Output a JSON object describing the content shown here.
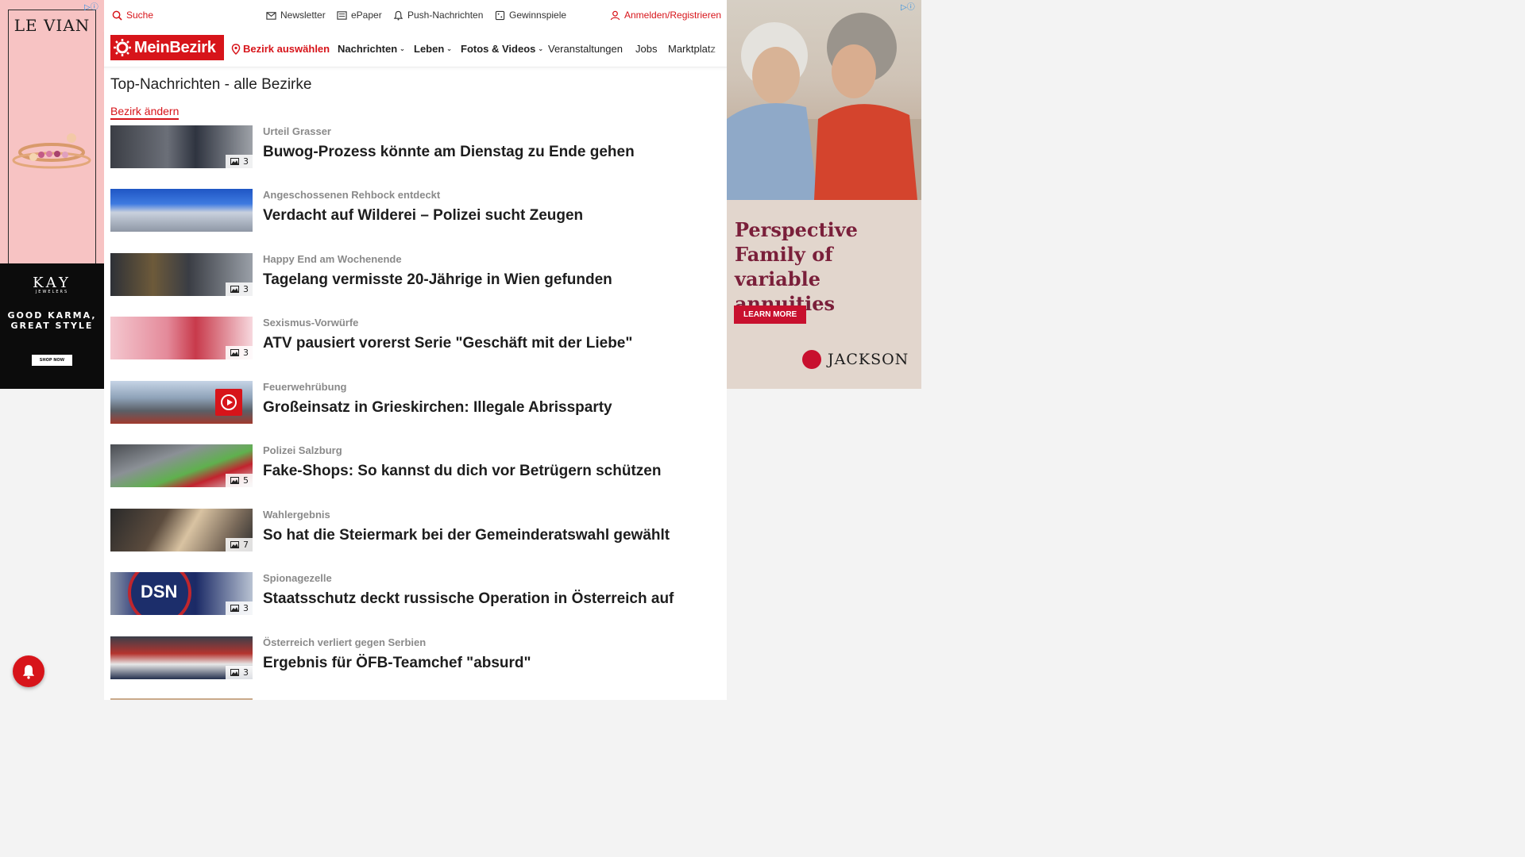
{
  "left_ad": {
    "brand": "LE VIAN",
    "kay_logo": "KAY",
    "kay_sub": "JEWELERS",
    "slogan_line1": "GOOD KARMA,",
    "slogan_line2": "GREAT STYLE",
    "cta": "SHOP NOW"
  },
  "utility_bar": {
    "search": "Suche",
    "newsletter": "Newsletter",
    "epaper": "ePaper",
    "push": "Push-Nachrichten",
    "contests": "Gewinnspiele",
    "login": "Anmelden/Registrieren"
  },
  "nav": {
    "logo": "MeinBezirk",
    "district": "Bezirk auswählen",
    "items": [
      {
        "label": "Nachrichten",
        "has_dropdown": true
      },
      {
        "label": "Leben",
        "has_dropdown": true
      },
      {
        "label": "Fotos & Videos",
        "has_dropdown": true
      },
      {
        "label": "Veranstaltungen",
        "has_dropdown": false
      },
      {
        "label": "Jobs",
        "has_dropdown": false
      },
      {
        "label": "Marktplatz",
        "has_dropdown": false
      }
    ]
  },
  "page": {
    "title": "Top-Nachrichten - alle Bezirke",
    "change_district": "Bezirk ändern"
  },
  "articles": [
    {
      "kicker": "Urteil Grasser",
      "headline": "Buwog-Prozess könnte am Dienstag zu Ende gehen",
      "photos": "3"
    },
    {
      "kicker": "Angeschossenen Rehbock entdeckt",
      "headline": "Verdacht auf Wilderei – Polizei sucht Zeugen",
      "photos": ""
    },
    {
      "kicker": "Happy End am Wochenende",
      "headline": "Tagelang vermisste 20-Jährige in Wien gefunden",
      "photos": "3"
    },
    {
      "kicker": "Sexismus-Vorwürfe",
      "headline": "ATV pausiert vorerst Serie \"Geschäft mit der Liebe\"",
      "photos": "3"
    },
    {
      "kicker": "Feuerwehrübung",
      "headline": "Großeinsatz in Grieskirchen: Illegale Abrissparty",
      "photos": "",
      "video": true
    },
    {
      "kicker": "Polizei Salzburg",
      "headline": "Fake-Shops: So kannst du dich vor Betrügern schützen",
      "photos": "5"
    },
    {
      "kicker": "Wahlergebnis",
      "headline": "So hat die Steiermark bei der Gemeinderatswahl gewählt",
      "photos": "7"
    },
    {
      "kicker": "Spionagezelle",
      "headline": "Staatsschutz deckt russische Operation in Österreich auf",
      "photos": "3",
      "thumb_text": "DSN"
    },
    {
      "kicker": "Österreich verliert gegen Serbien",
      "headline": "Ergebnis für ÖFB-Teamchef \"absurd\"",
      "photos": "3"
    }
  ],
  "right_ad": {
    "line1": "Perspective",
    "line2": "Family of variable",
    "line3": "annuities",
    "cta": "LEARN MORE",
    "brand": "JACKSON"
  },
  "colors": {
    "brand_red": "#d7141a",
    "ad_maroon": "#7a1f3a"
  }
}
